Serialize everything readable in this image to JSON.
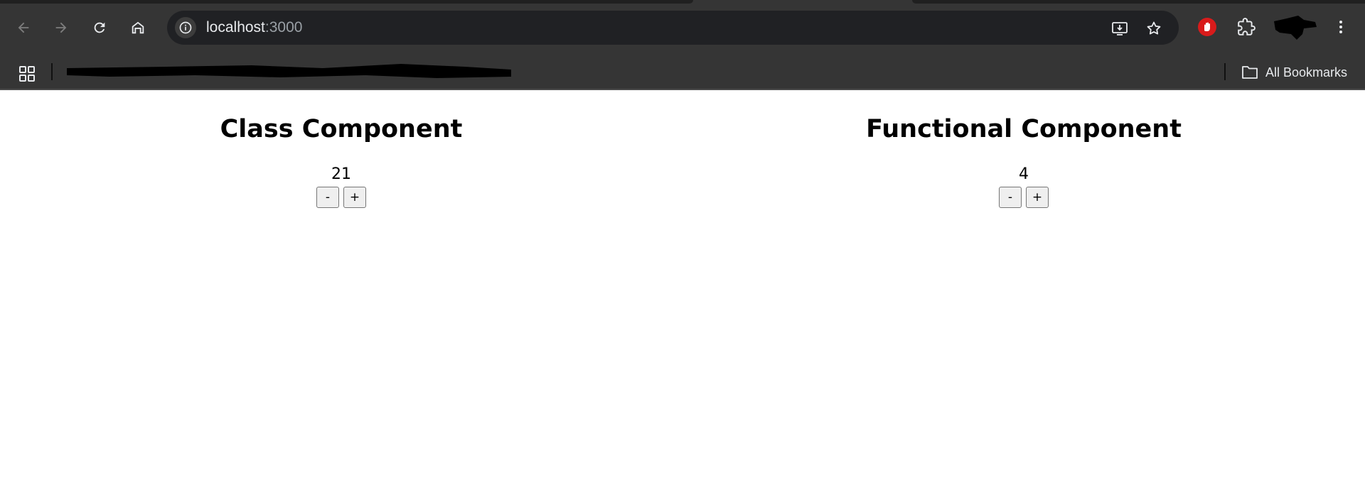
{
  "browser": {
    "url_host": "localhost",
    "url_port": ":3000",
    "all_bookmarks_label": "All Bookmarks",
    "colors": {
      "toolbar_bg": "#353535",
      "omnibox_bg": "#202124",
      "icon": "#e8eaed",
      "extension_red": "#d81b1b"
    },
    "toolbar_icons": [
      "back-arrow-icon",
      "forward-arrow-icon",
      "reload-icon",
      "home-icon",
      "site-info-icon",
      "install-app-icon",
      "bookmark-star-icon",
      "adblock-hand-icon",
      "extensions-puzzle-icon",
      "profile-avatar-icon",
      "menu-kebab-icon"
    ],
    "bookmark_icons": [
      "apps-grid-icon",
      "folder-icon"
    ]
  },
  "page": {
    "left": {
      "heading": "Class Component",
      "count": "21",
      "decrement_label": "-",
      "increment_label": "+"
    },
    "right": {
      "heading": "Functional Component",
      "count": "4",
      "decrement_label": "-",
      "increment_label": "+"
    }
  }
}
